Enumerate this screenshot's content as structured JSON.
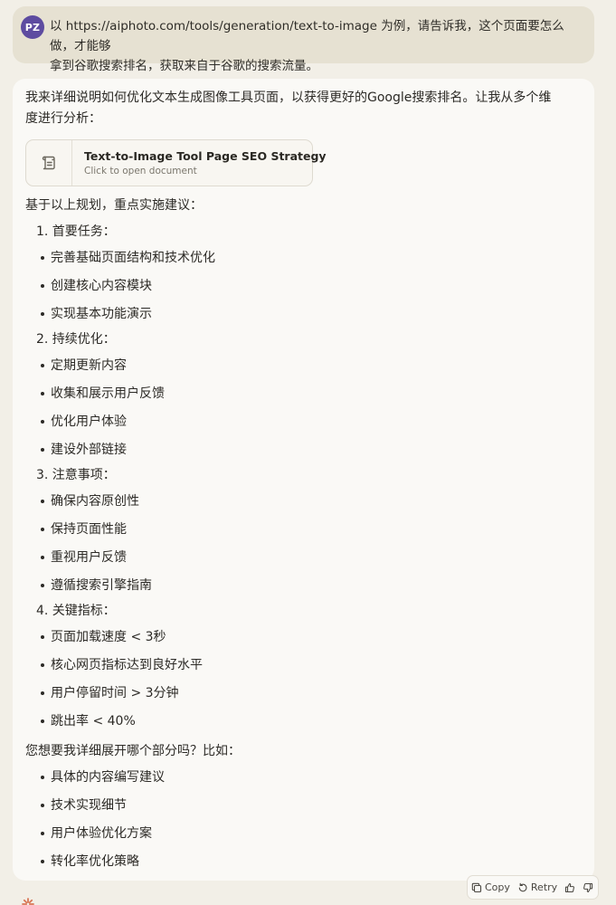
{
  "user": {
    "avatar_initials": "PZ",
    "message_line1": "以 https://aiphoto.com/tools/generation/text-to-image 为例，请告诉我，这个页面要怎么做，才能够",
    "message_line2": "拿到谷歌搜索排名，获取来自于谷歌的搜索流量。"
  },
  "assistant": {
    "intro": "我来详细说明如何优化文本生成图像工具页面，以获得更好的Google搜索排名。让我从多个维度进行分析：",
    "artifact": {
      "icon": "document-scroll-icon",
      "title": "Text-to-Image Tool Page SEO Strategy",
      "subtitle": "Click to open document"
    },
    "plan_heading": "基于以上规划，重点实施建议：",
    "sections": [
      {
        "title": "1. 首要任务：",
        "items": [
          "完善基础页面结构和技术优化",
          "创建核心内容模块",
          "实现基本功能演示"
        ]
      },
      {
        "title": "2. 持续优化：",
        "items": [
          "定期更新内容",
          "收集和展示用户反馈",
          "优化用户体验",
          "建设外部链接"
        ]
      },
      {
        "title": "3. 注意事项：",
        "items": [
          "确保内容原创性",
          "保持页面性能",
          "重视用户反馈",
          "遵循搜索引擎指南"
        ]
      },
      {
        "title": "4. 关键指标：",
        "items": [
          "页面加载速度 < 3秒",
          "核心网页指标达到良好水平",
          "用户停留时间 > 3分钟",
          "跳出率 < 40%"
        ]
      }
    ],
    "followup_question": "您想要我详细展开哪个部分吗？比如：",
    "followup_items": [
      "具体的内容编写建议",
      "技术实现细节",
      "用户体验优化方案",
      "转化率优化策略"
    ]
  },
  "actions": {
    "copy_label": "Copy",
    "retry_label": "Retry",
    "copy_icon": "copy-icon",
    "retry_icon": "retry-icon",
    "thumbs_up_icon": "thumbs-up-icon",
    "thumbs_down_icon": "thumbs-down-icon"
  },
  "colors": {
    "page_bg": "#f2efe7",
    "user_bubble": "#e6e1d2",
    "assistant_bubble": "#faf9f6",
    "avatar": "#5d4ba0",
    "logo_accent": "#d97757"
  }
}
